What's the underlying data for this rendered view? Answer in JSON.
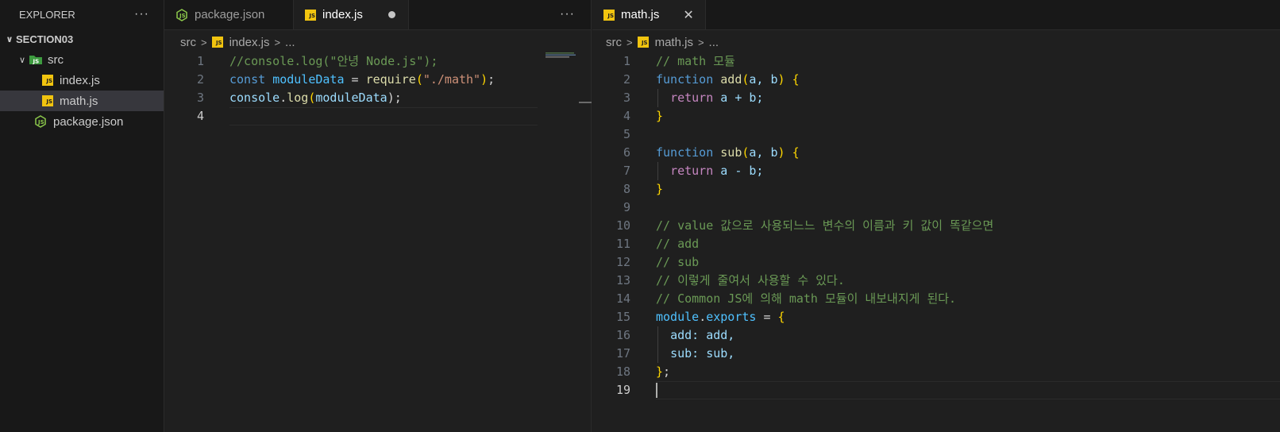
{
  "explorer": {
    "title": "EXPLORER",
    "more": "···",
    "root_folder": "SECTION03",
    "src_folder": "src",
    "files": {
      "index": "index.js",
      "math": "math.js",
      "package": "package.json"
    }
  },
  "left_group": {
    "tabs": [
      {
        "label": "package.json",
        "icon": "json-icon",
        "active": false
      },
      {
        "label": "index.js",
        "icon": "js-icon",
        "active": true,
        "modified": true
      }
    ],
    "more": "···",
    "breadcrumb": {
      "folder": "src",
      "file": "index.js",
      "ellipsis": "..."
    },
    "lines": [
      "1",
      "2",
      "3",
      "4"
    ]
  },
  "right_group": {
    "tab": {
      "label": "math.js",
      "icon": "js-icon",
      "close": "✕"
    },
    "breadcrumb": {
      "folder": "src",
      "file": "math.js",
      "ellipsis": "..."
    },
    "lines": [
      "1",
      "2",
      "3",
      "4",
      "5",
      "6",
      "7",
      "8",
      "9",
      "10",
      "11",
      "12",
      "13",
      "14",
      "15",
      "16",
      "17",
      "18",
      "19"
    ]
  },
  "code_index": {
    "l1": "//console.log(\"안녕 Node.js\");",
    "l2_const": "const",
    "l2_var": "moduleData",
    "l2_eq": " = ",
    "l2_fn": "require",
    "l2_str": "\"./math\"",
    "l2_end": ";",
    "l3_obj": "console",
    "l3_fn": "log",
    "l3_var": "moduleData",
    "l3_end": ");"
  },
  "code_math": {
    "c1": "// math 모듈",
    "function_kw": "function",
    "add_name": "add",
    "sub_name": "sub",
    "params": "a, b",
    "return_kw": "return",
    "add_expr": " a + b;",
    "sub_expr": " a - b;",
    "c10": "// value 값으로 사용되느느 변수의 이름과 키 값이 똑같으면",
    "c11": "// add",
    "c12": "// sub",
    "c13": "// 이렇게 줄여서 사용할 수 있다.",
    "c14": "// Common JS에 의해 math 모듈이 내보내지게 된다.",
    "module": "module",
    "exports": "exports",
    "p16": "add: add,",
    "p17": "sub: sub,",
    "end18": ";"
  },
  "colors": {
    "comment": "#6a9955",
    "keyword": "#569cd6",
    "control": "#c586c0",
    "function": "#dcdcaa",
    "variable": "#9cdcfe",
    "string": "#ce9178",
    "js_badge": "#f1c40f"
  }
}
